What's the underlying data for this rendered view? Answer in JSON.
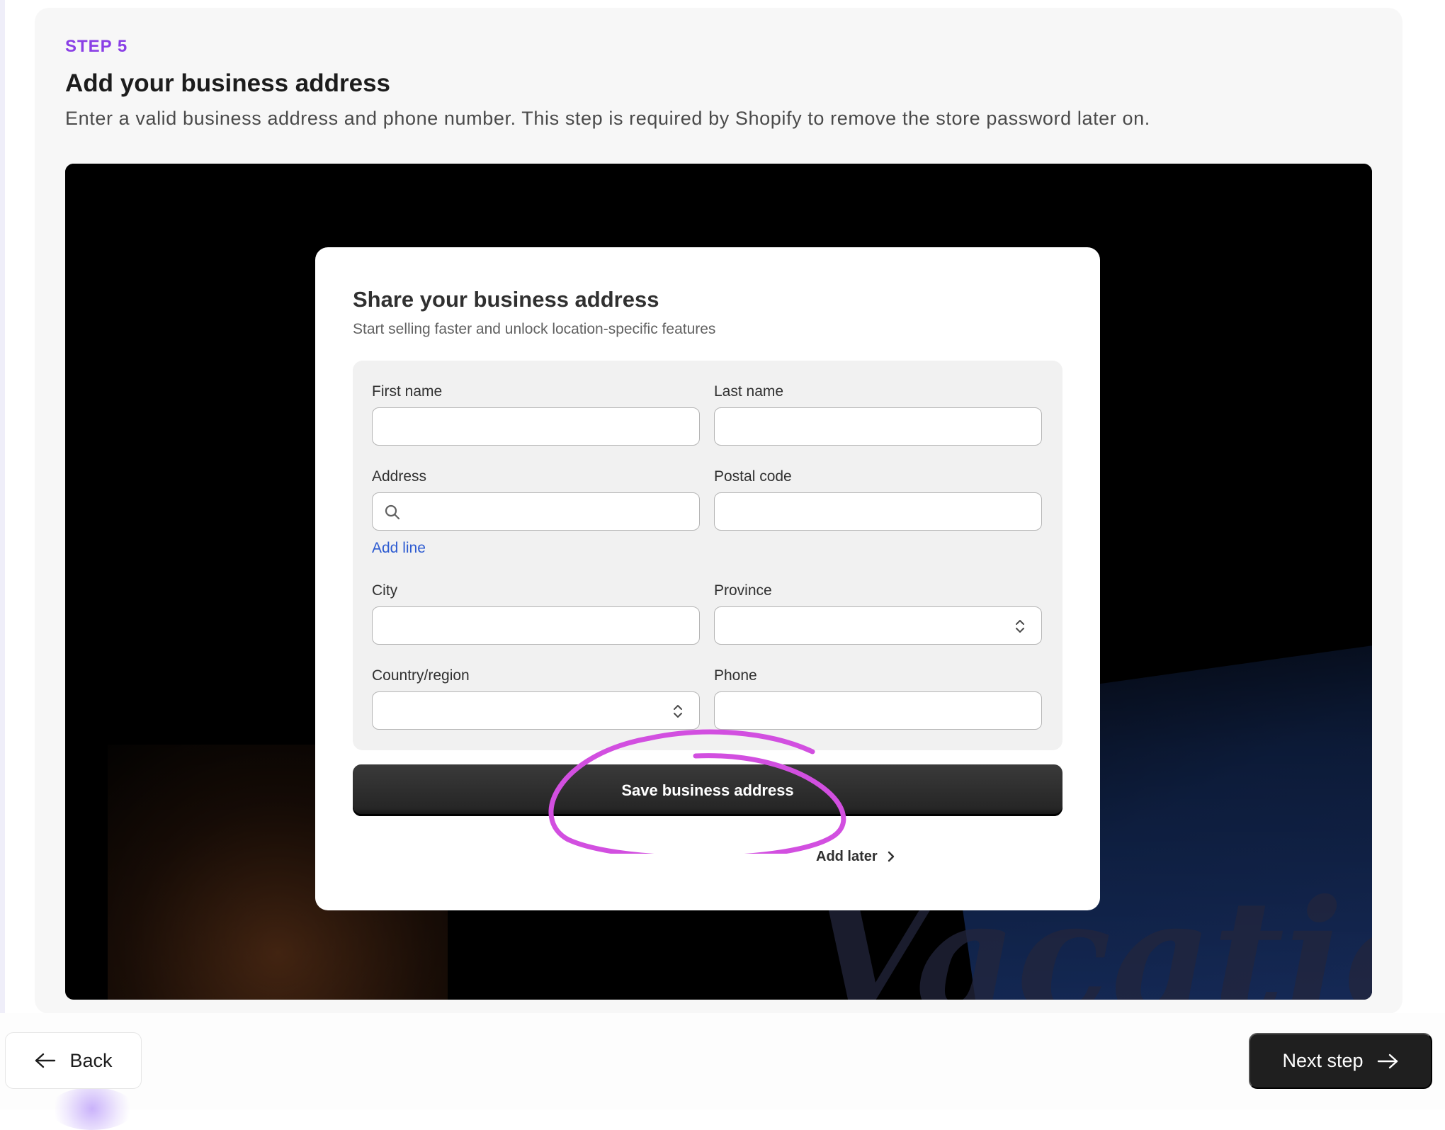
{
  "step": {
    "label": "STEP 5",
    "title": "Add your business address",
    "description": "Enter a valid business address and phone number. This step is required by Shopify to remove the store password later on."
  },
  "video": {
    "watermark_text": "Vacation",
    "modal": {
      "title": "Share your business address",
      "subtitle": "Start selling faster and unlock location-specific features",
      "fields": {
        "first_name": {
          "label": "First name",
          "value": ""
        },
        "last_name": {
          "label": "Last name",
          "value": ""
        },
        "address": {
          "label": "Address",
          "value": "",
          "icon": "search-icon"
        },
        "postal_code": {
          "label": "Postal code",
          "value": ""
        },
        "city": {
          "label": "City",
          "value": ""
        },
        "province": {
          "label": "Province",
          "value": "",
          "icon": "chevron-updown-icon"
        },
        "country": {
          "label": "Country/region",
          "value": "",
          "icon": "chevron-updown-icon"
        },
        "phone": {
          "label": "Phone",
          "value": ""
        }
      },
      "add_line_label": "Add line",
      "save_label": "Save business address",
      "add_later_label": "Add later"
    },
    "annotation_color": "#d24fe0"
  },
  "nav": {
    "back_label": "Back",
    "next_label": "Next step"
  },
  "colors": {
    "accent": "#8a3fe6",
    "link": "#2d5bd1",
    "primary_button": "#1f1f1f"
  }
}
